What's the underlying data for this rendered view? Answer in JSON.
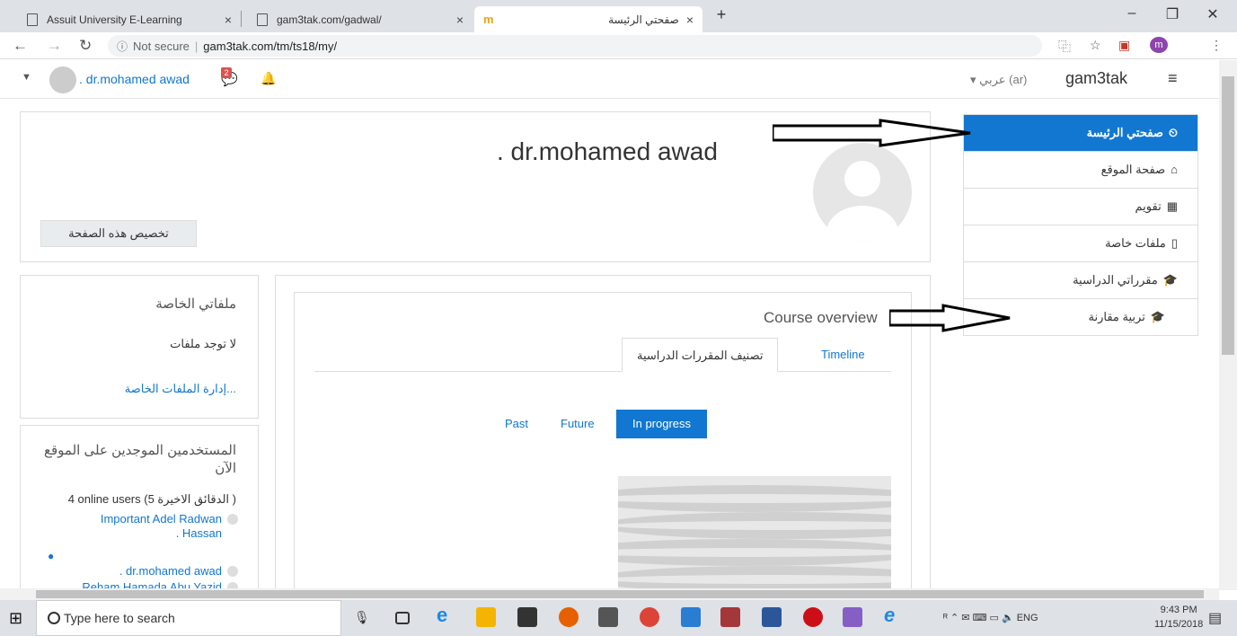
{
  "browser": {
    "tabs": [
      {
        "title": "Assuit University E-Learning"
      },
      {
        "title": "gam3tak.com/gadwal/"
      },
      {
        "title": "صفحتي الرئيسة"
      }
    ],
    "new_tab": "+",
    "url_prefix": "Not secure",
    "url": "gam3tak.com/tm/ts18/my/"
  },
  "navbar": {
    "username": ". dr.mohamed awad",
    "message_count": "2",
    "language": "عربي (ar)",
    "site_name": "gam3tak"
  },
  "header": {
    "fullname": ". dr.mohamed awad",
    "customize_button": "تخصيص هذه الصفحة"
  },
  "private_files": {
    "title": "ملفاتي الخاصة",
    "empty": "لا توجد ملفات",
    "manage_link": "إدارة الملفات الخاصة..."
  },
  "online_users": {
    "title": "المستخدمين الموجدين على الموقع الآن",
    "count": "4 online users (الدقائق الاخيرة 5 )",
    "users": [
      "Important Adel Radwan",
      ". Hassan",
      ". dr.mohamed awad",
      "Reham Hamada Abu Yazid"
    ]
  },
  "course_overview": {
    "title": "Course overview",
    "tabs": [
      "تصنيف المقررات الدراسية",
      "Timeline"
    ],
    "filters": [
      "Past",
      "Future",
      "In progress"
    ]
  },
  "drawer": {
    "items": [
      {
        "label": "صفحتي الرئيسة",
        "icon": "dashboard-icon"
      },
      {
        "label": "صفحة الموقع",
        "icon": "home-icon"
      },
      {
        "label": "تقويم",
        "icon": "calendar-icon"
      },
      {
        "label": "ملفات خاصة",
        "icon": "file-icon"
      },
      {
        "label": "مقرراتي الدراسية",
        "icon": "graduation-cap-icon"
      },
      {
        "label": "تربية مقارنة",
        "icon": "graduation-cap-icon"
      }
    ]
  },
  "taskbar": {
    "search_placeholder": "Type here to search",
    "lang": "ENG",
    "time": "9:43 PM",
    "date": "11/15/2018"
  },
  "colors": {
    "accent": "#1177d1"
  }
}
